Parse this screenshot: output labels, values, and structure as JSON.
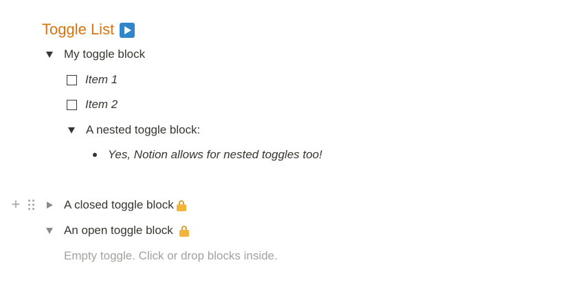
{
  "page": {
    "heading": "Toggle List",
    "heading_icon": "play-button-icon",
    "accent_color": "#d9730d"
  },
  "blocks": {
    "my_toggle": {
      "label": "My toggle block",
      "state": "open",
      "children": {
        "item1": {
          "label": "Item 1",
          "checked": false
        },
        "item2": {
          "label": "Item 2",
          "checked": false
        },
        "nested": {
          "label": "A nested toggle block:",
          "state": "open",
          "bullet": "Yes, Notion allows for nested toggles too!"
        }
      }
    },
    "closed_toggle": {
      "label": "A closed toggle block",
      "state": "closed",
      "icon": "lock-icon"
    },
    "open_toggle": {
      "label": "An open toggle block",
      "state": "open",
      "icon": "lock-icon",
      "placeholder": "Empty toggle. Click or drop blocks inside."
    }
  },
  "hover_controls": {
    "add_icon": "plus-icon",
    "drag_icon": "drag-handle-icon"
  }
}
